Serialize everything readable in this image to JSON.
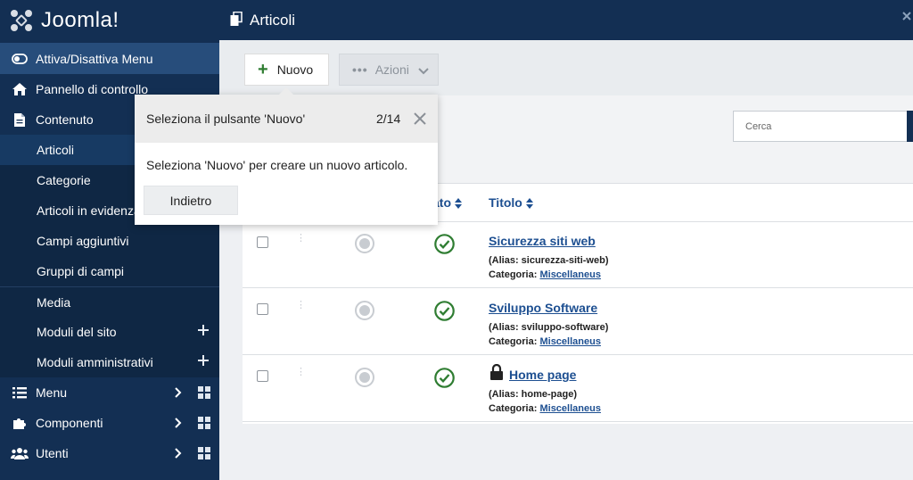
{
  "brand": {
    "name": "Joomla!"
  },
  "sidebar": {
    "toggle_label": "Attiva/Disattiva Menu",
    "items": [
      {
        "label": "Pannello di controllo",
        "icon": "home-icon"
      },
      {
        "label": "Contenuto",
        "icon": "file-icon"
      }
    ],
    "content_sub": [
      {
        "label": "Articoli",
        "active": true
      },
      {
        "label": "Categorie"
      },
      {
        "label": "Articoli in evidenza"
      },
      {
        "label": "Campi aggiuntivi"
      },
      {
        "label": "Gruppi di campi"
      },
      {
        "label": "Media"
      },
      {
        "label": "Moduli del sito"
      },
      {
        "label": "Moduli amministrativi"
      }
    ],
    "bottom_items": [
      {
        "label": "Menu",
        "icon": "list-icon"
      },
      {
        "label": "Componenti",
        "icon": "puzzle-icon"
      },
      {
        "label": "Utenti",
        "icon": "users-icon"
      }
    ]
  },
  "header": {
    "title": "Articoli"
  },
  "toolbar": {
    "new_label": "Nuovo",
    "actions_label": "Azioni"
  },
  "filters": {
    "search_placeholder": "Cerca"
  },
  "table": {
    "columns": {
      "status": "ato",
      "title": "Titolo"
    },
    "rows": [
      {
        "title": "Sicurezza siti web",
        "alias": "(Alias: sicurezza-siti-web)",
        "category_label": "Categoria:",
        "category": "Miscellaneus",
        "locked": false
      },
      {
        "title": "Sviluppo Software",
        "alias": "(Alias: sviluppo-software)",
        "category_label": "Categoria:",
        "category": "Miscellaneus",
        "locked": false
      },
      {
        "title": "Home page",
        "alias": "(Alias: home-page)",
        "category_label": "Categoria:",
        "category": "Miscellaneus",
        "locked": true
      }
    ]
  },
  "tour": {
    "title": "Seleziona il pulsante 'Nuovo'",
    "step": "2/14",
    "body": "Seleziona 'Nuovo' per creare un nuovo articolo.",
    "back_label": "Indietro"
  },
  "colors": {
    "sidebar_bg": "#132f53",
    "link": "#1d4f91",
    "success": "#2f7d32"
  }
}
